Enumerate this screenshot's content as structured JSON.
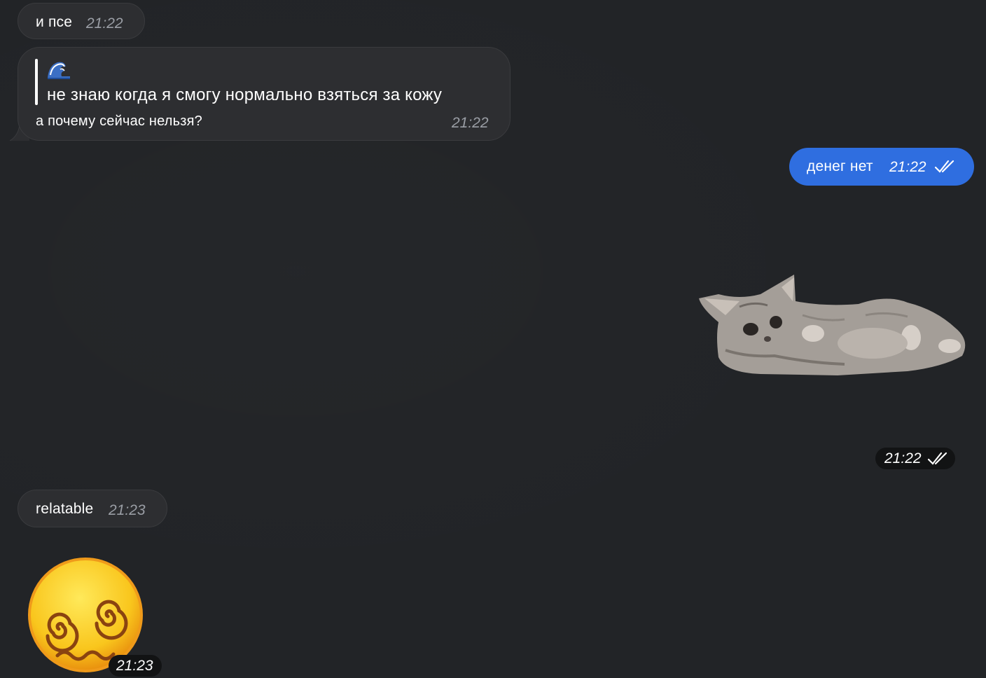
{
  "colors": {
    "background": "#222427",
    "incoming_bubble": "#2d2e31",
    "outgoing_bubble": "#2f6ee0",
    "time_muted": "#9a9ea5"
  },
  "messages": [
    {
      "direction": "incoming",
      "text": "и псе",
      "time": "21:22"
    },
    {
      "direction": "incoming",
      "reply": {
        "icon": "wave-emoji-icon",
        "text": "не знаю когда я смогу нормально взяться за кожу"
      },
      "text": "а почему сейчас нельзя?",
      "time": "21:22"
    },
    {
      "direction": "outgoing",
      "text": "денег нет",
      "time": "21:22",
      "status": "read"
    },
    {
      "direction": "outgoing",
      "type": "sticker",
      "sticker": "lying-kitten-sticker",
      "time": "21:22",
      "status": "read"
    },
    {
      "direction": "incoming",
      "text": "relatable",
      "time": "21:23"
    },
    {
      "direction": "incoming",
      "type": "sticker",
      "sticker": "dizzy-face-emoji-sticker",
      "time": "21:23"
    }
  ]
}
